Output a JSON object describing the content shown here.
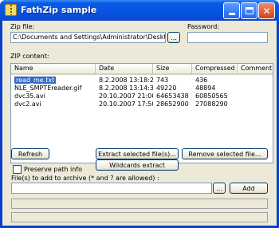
{
  "window": {
    "title": "FathZip sample"
  },
  "zip_file": {
    "label": "Zip file:",
    "value": "C:\\Documents and Settings\\Administrator\\Desktop\\",
    "browse_label": "..."
  },
  "password": {
    "label": "Password:",
    "value": ""
  },
  "zip_content": {
    "label": "ZIP content:",
    "columns": [
      "Name",
      "Date",
      "Size",
      "Compressed",
      "Comment"
    ],
    "rows": [
      {
        "name": "read_me.txt",
        "date": "8.2.2008 13:18:28",
        "size": "743",
        "compressed": "436",
        "comment": ""
      },
      {
        "name": "NLE_SMPTEreader.gif",
        "date": "8.2.2008 13:14:32",
        "size": "49220",
        "compressed": "48894",
        "comment": ""
      },
      {
        "name": "dvc35.avi",
        "date": "20.10.2007 21:00:...",
        "size": "64653438",
        "compressed": "60850565",
        "comment": ""
      },
      {
        "name": "dvc2.avi",
        "date": "20.10.2007 17:50:...",
        "size": "28652900",
        "compressed": "27088290",
        "comment": ""
      }
    ]
  },
  "buttons": {
    "refresh": "Refresh",
    "extract_selected": "Extract selected file(s)...",
    "remove_selected": "Remove selected file...",
    "wildcards_extract": "Wildcards extract",
    "add": "Add"
  },
  "preserve_path": {
    "label": "Preserve path info",
    "checked": false
  },
  "add_files": {
    "label": "File(s) to add to archive (* and ? are allowed) :",
    "value": "",
    "browse_label": "..."
  }
}
